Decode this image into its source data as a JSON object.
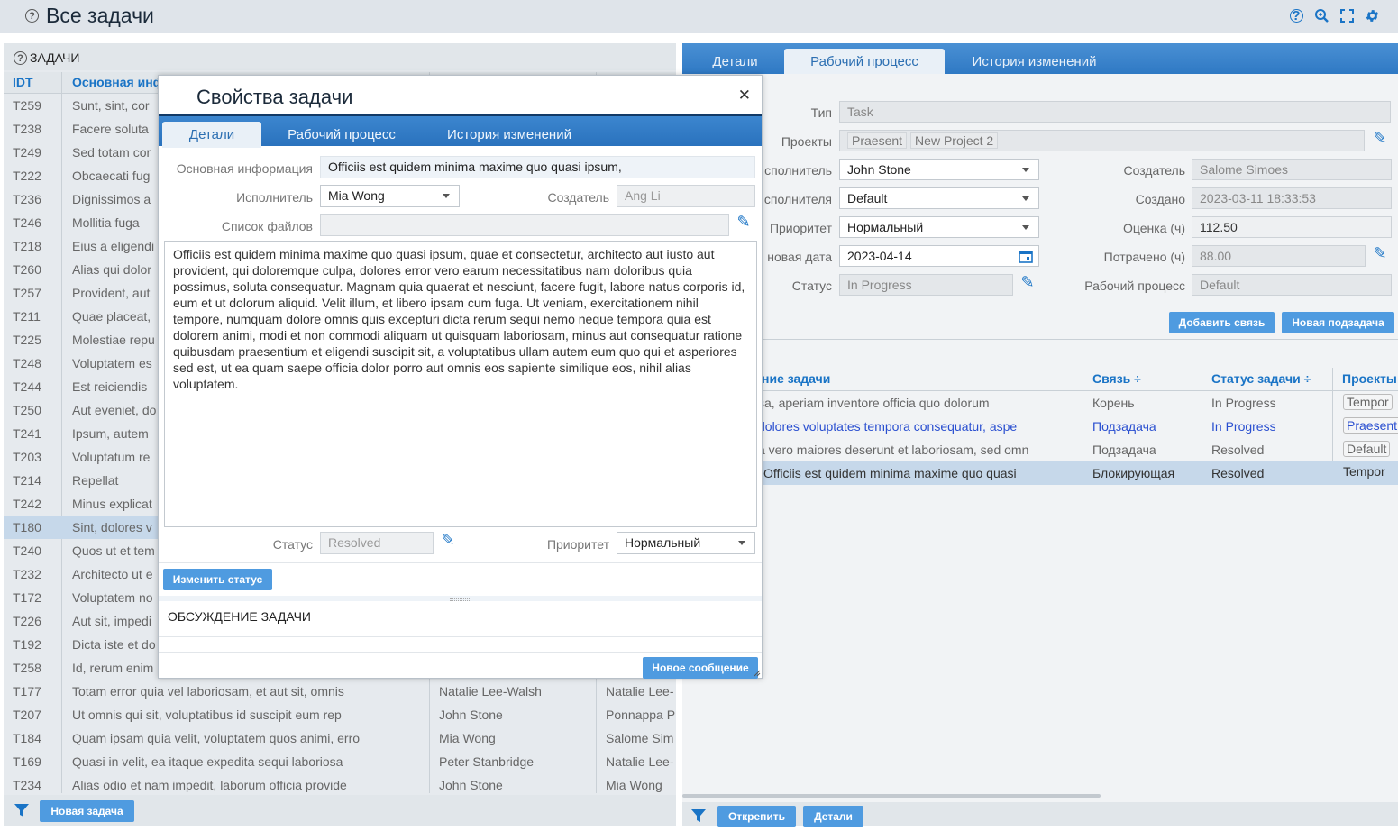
{
  "header": {
    "title": "Все задачи",
    "icons": [
      "help-icon",
      "zoom-icon",
      "fullscreen-icon",
      "gear-icon"
    ]
  },
  "left_panel": {
    "title": "ЗАДАЧИ",
    "columns": [
      "IDT",
      "Основная инфо"
    ],
    "rows": [
      {
        "id": "T259",
        "info": "Sunt, sint, cor",
        "assignee": "",
        "creator": ""
      },
      {
        "id": "T238",
        "info": "Facere soluta",
        "assignee": "",
        "creator": ""
      },
      {
        "id": "T249",
        "info": "Sed totam cor",
        "assignee": "",
        "creator": ""
      },
      {
        "id": "T222",
        "info": "Obcaecati fug",
        "assignee": "",
        "creator": ""
      },
      {
        "id": "T236",
        "info": "Dignissimos a",
        "assignee": "",
        "creator": ""
      },
      {
        "id": "T246",
        "info": "Mollitia fuga",
        "assignee": "",
        "creator": ""
      },
      {
        "id": "T218",
        "info": "Eius a eligendi",
        "assignee": "",
        "creator": ""
      },
      {
        "id": "T260",
        "info": "Alias qui dolor",
        "assignee": "",
        "creator": ""
      },
      {
        "id": "T257",
        "info": "Provident, aut",
        "assignee": "",
        "creator": ""
      },
      {
        "id": "T211",
        "info": "Quae placeat,",
        "assignee": "",
        "creator": ""
      },
      {
        "id": "T225",
        "info": "Molestiae repu",
        "assignee": "",
        "creator": ""
      },
      {
        "id": "T248",
        "info": "Voluptatem es",
        "assignee": "",
        "creator": ""
      },
      {
        "id": "T244",
        "info": "Est reiciendis",
        "assignee": "",
        "creator": ""
      },
      {
        "id": "T250",
        "info": "Aut eveniet, do",
        "assignee": "",
        "creator": ""
      },
      {
        "id": "T241",
        "info": "Ipsum, autem",
        "assignee": "",
        "creator": ""
      },
      {
        "id": "T203",
        "info": "Voluptatum re",
        "assignee": "",
        "creator": ""
      },
      {
        "id": "T214",
        "info": "Repellat",
        "assignee": "",
        "creator": ""
      },
      {
        "id": "T242",
        "info": "Minus explicat",
        "assignee": "",
        "creator": ""
      },
      {
        "id": "T180",
        "info": "Sint, dolores v",
        "assignee": "",
        "creator": ""
      },
      {
        "id": "T240",
        "info": "Quos ut et tem",
        "assignee": "",
        "creator": ""
      },
      {
        "id": "T232",
        "info": "Architecto ut e",
        "assignee": "",
        "creator": ""
      },
      {
        "id": "T172",
        "info": "Voluptatem no",
        "assignee": "",
        "creator": ""
      },
      {
        "id": "T226",
        "info": "Aut sit, impedi",
        "assignee": "",
        "creator": ""
      },
      {
        "id": "T192",
        "info": "Dicta iste et do",
        "assignee": "",
        "creator": ""
      },
      {
        "id": "T258",
        "info": "Id, rerum enim",
        "assignee": "",
        "creator": ""
      },
      {
        "id": "T177",
        "info": "Totam error quia vel laboriosam, et aut sit, omnis",
        "assignee": "Natalie Lee-Walsh",
        "creator": "Natalie Lee-"
      },
      {
        "id": "T207",
        "info": "Ut omnis qui sit, voluptatibus id suscipit eum rep",
        "assignee": "John Stone",
        "creator": "Ponnappa P"
      },
      {
        "id": "T184",
        "info": "Quam ipsam quia velit, voluptatem quos animi, erro",
        "assignee": "Mia Wong",
        "creator": "Salome Sim"
      },
      {
        "id": "T169",
        "info": "Quasi in velit, ea itaque expedita sequi laboriosa",
        "assignee": "Peter Stanbridge",
        "creator": "Natalie Lee-"
      },
      {
        "id": "T234",
        "info": "Alias odio et nam impedit, laborum officia provide",
        "assignee": "John Stone",
        "creator": "Mia Wong"
      }
    ],
    "new_task_button": "Новая задача"
  },
  "right_panel": {
    "tabs": [
      "Детали",
      "Рабочий процесс",
      "История изменений"
    ],
    "fields": {
      "type_label": "Тип",
      "type_value": "Task",
      "projects_label": "Проекты",
      "project_1": "Praesent",
      "project_2": "New Project 2",
      "assignee_label": "сполнитель",
      "assignee_value": "John Stone",
      "assignee2_label": "сполнителя",
      "assignee2_value": "Default",
      "priority_label": "Приоритет",
      "priority_value": "Нормальный",
      "date_label": "новая дата",
      "date_value": "2023-04-14",
      "status_label": "Статус",
      "status_value": "In Progress",
      "creator_label": "Создатель",
      "creator_value": "Salome Simoes",
      "created_label": "Создано",
      "created_value": "2023-03-11 18:33:53",
      "estimate_label": "Оценка (ч)",
      "estimate_value": "112.50",
      "spent_label": "Потрачено (ч)",
      "spent_value": "88.00",
      "workflow_label": "Рабочий процесс",
      "workflow_value": "Default"
    },
    "add_link_button": "Добавить связь",
    "new_subtask_button": "Новая подзадача",
    "table": {
      "headers": [
        "ние задачи",
        "Связь ÷",
        "Статус задачи ÷",
        "Проекты"
      ],
      "rows": [
        {
          "name": "sa, aperiam inventore officia quo dolorum",
          "link": "Корень",
          "status": "In Progress",
          "project": "Tempor"
        },
        {
          "name": "dolores voluptates tempora consequatur, aspe",
          "link": "Подзадача",
          "status": "In Progress",
          "project": "Praesent"
        },
        {
          "name": "a vero maiores deserunt et laboriosam, sed omn",
          "link": "Подзадача",
          "status": "Resolved",
          "project": "Default"
        },
        {
          "name": "Officiis est quidem minima maxime quo quasi",
          "link": "Блокирующая",
          "status": "Resolved",
          "project": "Tempor"
        }
      ]
    },
    "unpin_button": "Открепить",
    "details_button": "Детали"
  },
  "modal": {
    "title": "Свойства задачи",
    "tabs": [
      "Детали",
      "Рабочий процесс",
      "История изменений"
    ],
    "main_info_label": "Основная информация",
    "main_info_value": "Officiis est quidem minima maxime quo quasi ipsum,",
    "assignee_label": "Исполнитель",
    "assignee_value": "Mia Wong",
    "creator_label": "Создатель",
    "creator_value": "Ang Li",
    "files_label": "Список файлов",
    "description": "Officiis est quidem minima maxime quo quasi ipsum, quae et consectetur, architecto aut iusto aut provident, qui doloremque culpa, dolores error vero earum necessitatibus nam doloribus quia possimus, soluta consequatur. Magnam quia quaerat et nesciunt, facere fugit, labore natus corporis id, eum et ut dolorum aliquid. Velit illum, et libero ipsam cum fuga. Ut veniam, exercitationem nihil tempore, numquam dolore omnis quis excepturi dicta rerum sequi nemo neque tempora quia est dolorem animi, modi et non commodi aliquam ut quisquam laboriosam, minus aut consequatur ratione quibusdam praesentium et eligendi suscipit sit, a voluptatibus ullam autem eum quo qui et asperiores sed est, ut ea quam saepe officia dolor porro aut omnis eos sapiente similique eos, nihil alias voluptatem.",
    "status_label": "Статус",
    "status_value": "Resolved",
    "priority_label": "Приоритет",
    "priority_value": "Нормальный",
    "change_status_button": "Изменить статус",
    "discussion_title": "ОБСУЖДЕНИЕ ЗАДАЧИ",
    "new_message_button": "Новое сообщение"
  }
}
